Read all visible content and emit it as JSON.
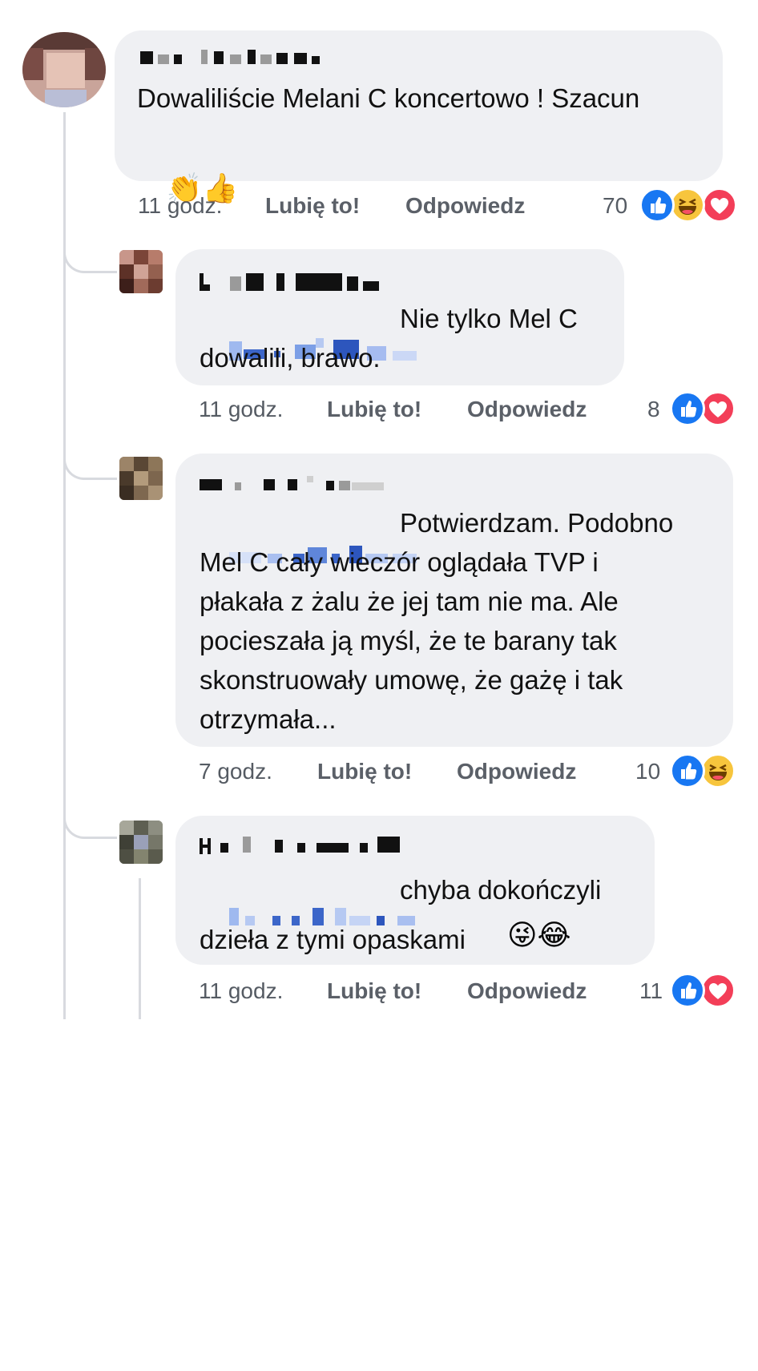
{
  "comments": [
    {
      "text": "Dowaliliście Melani C koncertowo ! Szacun",
      "emojis": "👏👍",
      "time": "11 godz.",
      "like_label": "Lubię to!",
      "reply_label": "Odpowiedz",
      "reaction_count": "70",
      "reactions": [
        "like",
        "haha",
        "love"
      ]
    },
    {
      "text": "Nie tylko Mel C\ndowalili, brawo.",
      "time": "11 godz.",
      "like_label": "Lubię to!",
      "reply_label": "Odpowiedz",
      "reaction_count": "8",
      "reactions": [
        "like",
        "love"
      ]
    },
    {
      "text": "Potwierdzam. Podobno\nMel C cały wieczór oglądała TVP i\npłakała z żalu że jej tam nie ma. Ale\npocieszała ją myśl, że te barany tak\nskonstruowały umowę, że gażę i tak\notrzymała...",
      "time": "7 godz.",
      "like_label": "Lubię to!",
      "reply_label": "Odpowiedz",
      "reaction_count": "10",
      "reactions": [
        "like",
        "haha"
      ]
    },
    {
      "text": "chyba dokończyli\ndzieła z tymi opaskami",
      "emojis": "😜😂",
      "time": "11 godz.",
      "like_label": "Lubię to!",
      "reply_label": "Odpowiedz",
      "reaction_count": "11",
      "reactions": [
        "like",
        "love"
      ]
    }
  ],
  "colors": {
    "bubble": "#eff0f3",
    "like": "#1877f2",
    "love": "#f33e58",
    "haha": "#f7c53d"
  }
}
